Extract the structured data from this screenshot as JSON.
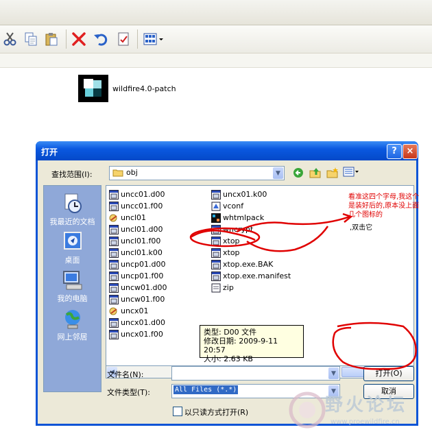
{
  "explorer": {
    "toolbar_icons": [
      "cut-icon",
      "copy-icon",
      "paste-icon",
      "delete-icon",
      "undo-icon",
      "properties-icon",
      "views-icon"
    ],
    "file_label": "wildfire4.0-patch"
  },
  "dialog": {
    "title": "打开",
    "help_label": "?",
    "close_label": "×",
    "look_in_label": "查找范围(I):",
    "look_in_value": "obj",
    "places": [
      {
        "label": "我最近的文档",
        "icon": "recent-documents-icon"
      },
      {
        "label": "桌面",
        "icon": "desktop-icon"
      },
      {
        "label": "我的电脑",
        "icon": "my-computer-icon"
      },
      {
        "label": "网上邻居",
        "icon": "network-places-icon"
      }
    ],
    "files_col1": [
      "uncc01.d00",
      "uncc01.f00",
      "uncl01",
      "uncl01.d00",
      "uncl01.f00",
      "uncl01.k00",
      "uncp01.d00",
      "uncp01.f00",
      "uncw01.d00",
      "uncw01.f00",
      "uncx01",
      "uncx01.d00",
      "uncx01.f00"
    ],
    "files_col2": [
      "uncx01.k00",
      "vconf",
      "whtmlpack",
      "wncrypt",
      "xtop",
      "xtop",
      "xtop.exe.BAK",
      "xtop.exe.manifest",
      "zip"
    ],
    "tooltip": {
      "type": "类型: D00 文件",
      "modified": "修改日期: 2009-9-11 20:57",
      "size": "大小: 2.63 KB"
    },
    "filename_label": "文件名(N):",
    "filename_value": "",
    "filetype_label": "文件类型(T):",
    "filetype_value": "All Files (*.*)",
    "readonly_label": "以只读方式打开(R)",
    "open_button": "打开(O)",
    "cancel_button": "取消"
  },
  "annotation": {
    "red_text": "看准这四个字母,我这个是装好后的,原本没上面几个图标的",
    "black_text": ",双击它"
  },
  "watermark": {
    "title": "野火论坛",
    "url": "www.proewildfire.cn"
  },
  "colors": {
    "dialog_blue": "#0a54d6",
    "dialog_face": "#ece9d8",
    "places_bar": "#8fa8d8",
    "annotation_red": "#e00000",
    "tooltip_bg": "#ffffe1"
  }
}
